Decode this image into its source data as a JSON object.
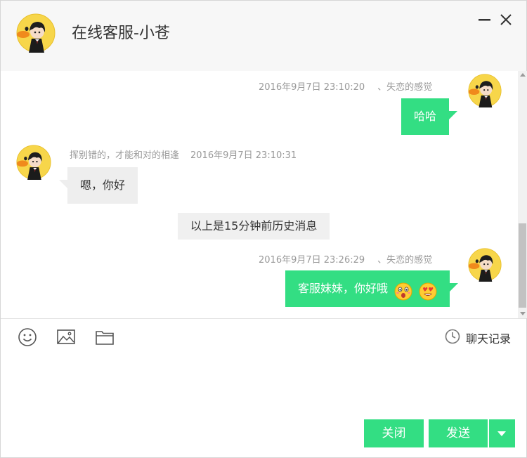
{
  "header": {
    "title": "在线客服-小苍"
  },
  "messages": {
    "m1": {
      "timestamp": "2016年9月7日 23:10:20",
      "sender": "、失恋的感觉",
      "text": "哈哈"
    },
    "m2": {
      "sender": "挥别错的，才能和对的相逢",
      "timestamp": "2016年9月7日 23:10:31",
      "text": "嗯，你好"
    },
    "history_note": "以上是15分钟前历史消息",
    "m3": {
      "timestamp": "2016年9月7日 23:26:29",
      "sender": "、失恋的感觉",
      "text": "客服妹妹，你好哦"
    }
  },
  "toolbar": {
    "history_label": "聊天记录"
  },
  "footer": {
    "close_label": "关闭",
    "send_label": "发送"
  },
  "colors": {
    "accent": "#33de83",
    "header_bg": "#f7f7f7",
    "incoming_bubble": "#eeeeee"
  },
  "icons": [
    "minimize-icon",
    "close-icon",
    "emoji-icon",
    "image-icon",
    "folder-icon",
    "clock-icon",
    "dropdown-arrow-icon",
    "surprised-emoji-icon",
    "heart-eyes-emoji-icon"
  ]
}
